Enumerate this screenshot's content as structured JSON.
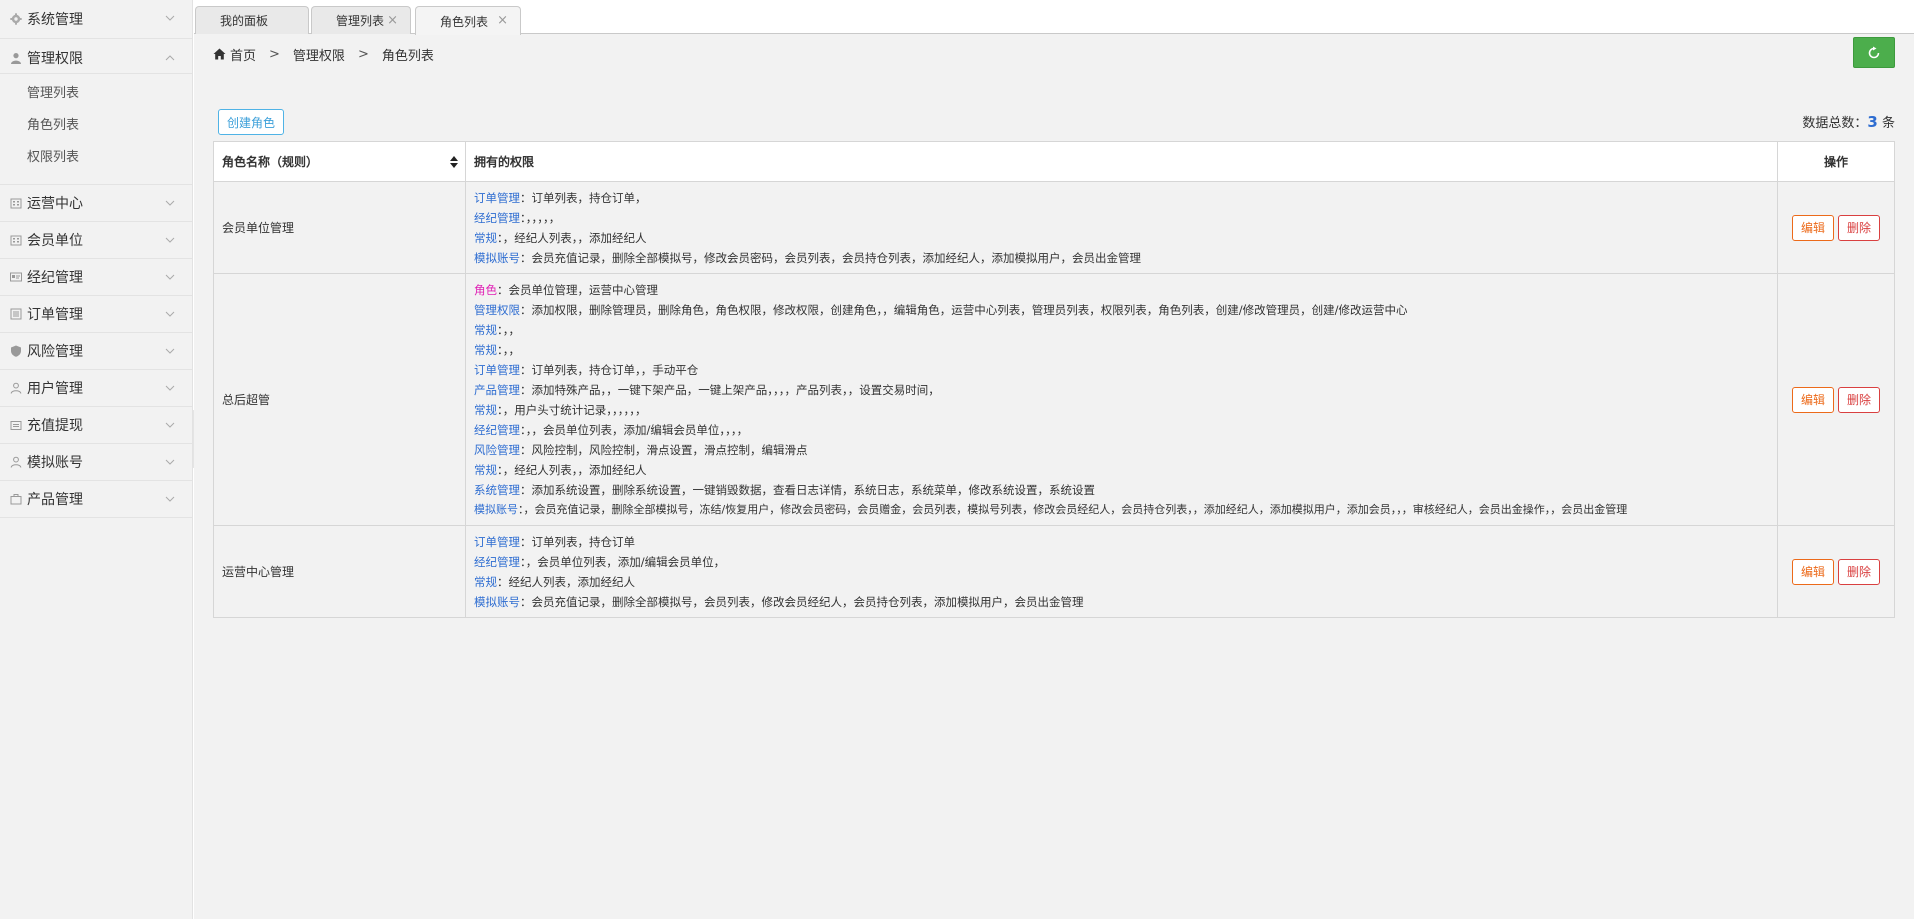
{
  "sidebar": {
    "top": {
      "label": "系统管理",
      "icon": "gear-icon"
    },
    "open_group": {
      "label": "管理权限",
      "icon": "user-icon"
    },
    "subitems": [
      {
        "label": "管理列表"
      },
      {
        "label": "角色列表"
      },
      {
        "label": "权限列表"
      }
    ],
    "items": [
      {
        "label": "运营中心",
        "icon": "building-icon"
      },
      {
        "label": "会员单位",
        "icon": "building-icon"
      },
      {
        "label": "经纪管理",
        "icon": "id-card-icon"
      },
      {
        "label": "订单管理",
        "icon": "list-icon"
      },
      {
        "label": "风险管理",
        "icon": "shield-icon"
      },
      {
        "label": "用户管理",
        "icon": "user-outline-icon"
      },
      {
        "label": "充值提现",
        "icon": "wallet-icon"
      },
      {
        "label": "模拟账号",
        "icon": "user-outline-icon"
      },
      {
        "label": "产品管理",
        "icon": "briefcase-icon"
      }
    ]
  },
  "tabs": [
    {
      "label": "我的面板",
      "closable": false
    },
    {
      "label": "管理列表",
      "closable": true
    },
    {
      "label": "角色列表",
      "closable": true,
      "active": true
    }
  ],
  "tab_close_glyph": "×",
  "breadcrumb": {
    "home": "首页",
    "sep": ">",
    "level1": "管理权限",
    "level2": "角色列表"
  },
  "toolbar": {
    "create_label": "创建角色",
    "total_prefix": "数据总数：",
    "total_count": "3",
    "total_suffix": " 条"
  },
  "table": {
    "headers": {
      "name": "角色名称（规则）",
      "perms": "拥有的权限",
      "ops": "操作"
    },
    "edit_label": "编辑",
    "delete_label": "删除",
    "rows": [
      {
        "name": "会员单位管理",
        "perms": [
          {
            "key": "订单管理",
            "text": "：订单列表，持仓订单，"
          },
          {
            "key": "经纪管理",
            "text": "：，，，，，"
          },
          {
            "key": "常规",
            "text": "：，经纪人列表，，添加经纪人"
          },
          {
            "key": "模拟账号",
            "text": "：会员充值记录，删除全部模拟号，修改会员密码，会员列表，会员持仓列表，添加经纪人，添加模拟用户，会员出金管理"
          }
        ]
      },
      {
        "name": "总后超管",
        "perms": [
          {
            "key": "角色",
            "text": "：会员单位管理，运营中心管理",
            "pink": true
          },
          {
            "key": "管理权限",
            "text": "：添加权限，删除管理员，删除角色，角色权限，修改权限，创建角色，，编辑角色，运营中心列表，管理员列表，权限列表，角色列表，创建/修改管理员，创建/修改运营中心"
          },
          {
            "key": "常规",
            "text": "：，，"
          },
          {
            "key": "常规",
            "text": "：，，"
          },
          {
            "key": "订单管理",
            "text": "：订单列表，持仓订单，，手动平仓"
          },
          {
            "key": "产品管理",
            "text": "：添加特殊产品，，一键下架产品，一键上架产品，，，，产品列表，，设置交易时间，"
          },
          {
            "key": "常规",
            "text": "：，用户头寸统计记录，，，，，，"
          },
          {
            "key": "经纪管理",
            "text": "：，，会员单位列表，添加/编辑会员单位，，，，"
          },
          {
            "key": "风险管理",
            "text": "：风险控制，风险控制，滑点设置，滑点控制，编辑滑点"
          },
          {
            "key": "常规",
            "text": "：，经纪人列表，，添加经纪人"
          },
          {
            "key": "系统管理",
            "text": "：添加系统设置，删除系统设置，一键销毁数据，查看日志详情，系统日志，系统菜单，修改系统设置，系统设置"
          },
          {
            "key": "模拟账号",
            "text": "：，会员充值记录，删除全部模拟号，冻结/恢复用户，修改会员密码，会员赠金，会员列表，模拟号列表，修改会员经纪人，会员持仓列表，，添加经纪人，添加模拟用户，添加会员，，，审核经纪人，会员出金操作，，会员出金管理"
          }
        ]
      },
      {
        "name": "运营中心管理",
        "perms": [
          {
            "key": "订单管理",
            "text": "：订单列表，持仓订单"
          },
          {
            "key": "经纪管理",
            "text": "：，会员单位列表，添加/编辑会员单位，"
          },
          {
            "key": "常规",
            "text": "：经纪人列表，添加经纪人"
          },
          {
            "key": "模拟账号",
            "text": "：会员充值记录，删除全部模拟号，会员列表，修改会员经纪人，会员持仓列表，添加模拟用户，会员出金管理"
          }
        ]
      }
    ]
  }
}
